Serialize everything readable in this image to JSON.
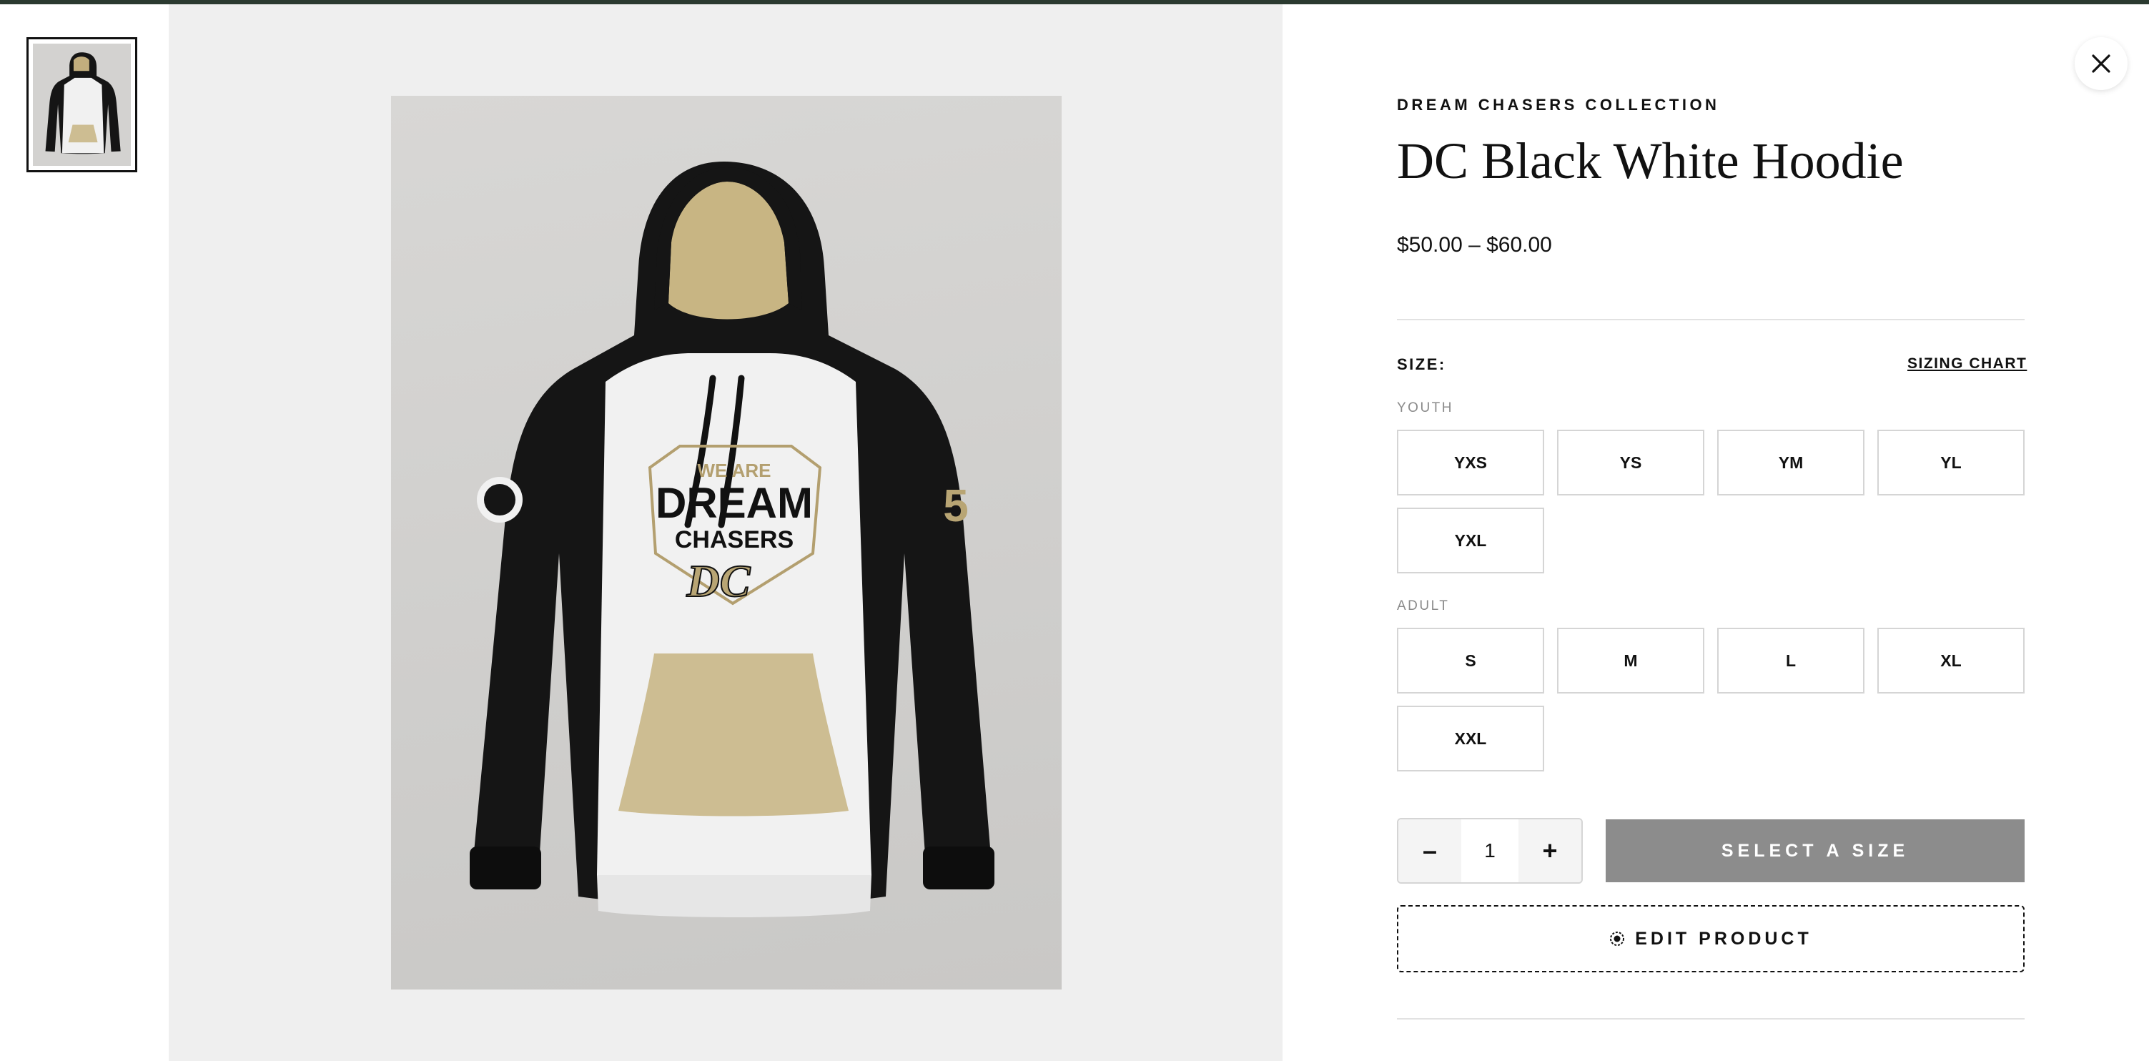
{
  "product": {
    "collection": "DREAM CHASERS COLLECTION",
    "title": "DC Black White Hoodie",
    "price": "$50.00 – $60.00",
    "image_alt": "DC Black White Hoodie",
    "print": {
      "line1": "WE ARE",
      "line2": "DREAM",
      "line3": "CHASERS",
      "monogram": "DC",
      "sleeve_number": "5"
    }
  },
  "sizes": {
    "label": "SIZE:",
    "chart_link": "SIZING CHART",
    "groups": [
      {
        "label": "YOUTH",
        "options": [
          "YXS",
          "YS",
          "YM",
          "YL",
          "YXL"
        ]
      },
      {
        "label": "ADULT",
        "options": [
          "S",
          "M",
          "L",
          "XL",
          "XXL"
        ]
      }
    ]
  },
  "quantity": {
    "decrease": "–",
    "value": "1",
    "increase": "+"
  },
  "actions": {
    "add_to_cart": "SELECT A SIZE",
    "edit_product": "EDIT PRODUCT"
  },
  "icons": {
    "close": "close-icon",
    "edit": "gear-icon"
  },
  "colors": {
    "hoodie_black": "#151515",
    "hoodie_white": "#f1f1f1",
    "hoodie_tan": "#cdbd92",
    "button_disabled": "#8c8c8c",
    "top_bar": "#2b3a30"
  }
}
